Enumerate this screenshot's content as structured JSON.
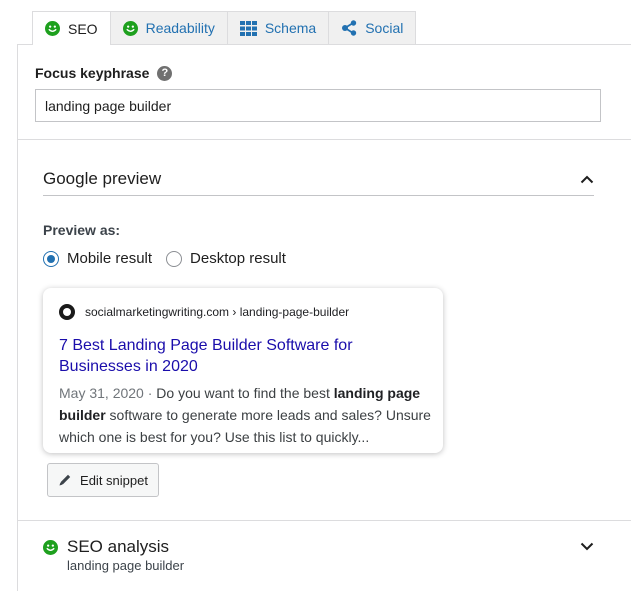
{
  "tabs": [
    {
      "label": "SEO",
      "icon": "smiley-icon",
      "active": true
    },
    {
      "label": "Readability",
      "icon": "smiley-icon"
    },
    {
      "label": "Schema",
      "icon": "grid-icon"
    },
    {
      "label": "Social",
      "icon": "share-icon"
    }
  ],
  "focus_keyphrase": {
    "label": "Focus keyphrase",
    "value": "landing page builder"
  },
  "google_preview": {
    "title": "Google preview",
    "preview_as_label": "Preview as:",
    "options": [
      "Mobile result",
      "Desktop result"
    ],
    "selected": "Mobile result",
    "card": {
      "url": "socialmarketingwriting.com › landing-page-builder",
      "title": "7 Best Landing Page Builder Software for Businesses in 2020",
      "date": "May 31, 2020",
      "separator": " · ",
      "desc_part1": "Do you want to find the best ",
      "desc_bold1": "landing page builder",
      "desc_part2": " software to generate more leads and sales? Unsure which one is best for you? Use this list to quickly..."
    },
    "edit_snippet_label": "Edit snippet"
  },
  "seo_analysis": {
    "title": "SEO analysis",
    "subtitle": "landing page builder"
  },
  "colors": {
    "accent": "#2271b1",
    "good": "#1ea01e",
    "link": "#1a0dab"
  }
}
